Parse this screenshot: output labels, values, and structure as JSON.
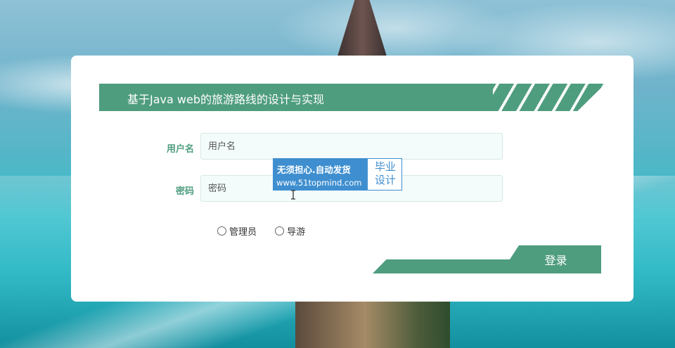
{
  "title": "基于Java web的旅游路线的设计与实现",
  "form": {
    "username": {
      "label": "用户名",
      "placeholder": "用户名",
      "value": ""
    },
    "password": {
      "label": "密码",
      "placeholder": "密码",
      "value": ""
    },
    "roles": [
      {
        "label": "管理员",
        "selected": false
      },
      {
        "label": "导游",
        "selected": false
      }
    ],
    "login_label": "登录"
  },
  "watermark": {
    "line1": "无须担心.自动发货",
    "line2": "www.51topmind.com",
    "side_top": "毕业",
    "side_bottom": "设计"
  },
  "colors": {
    "accent": "#4f9d7f",
    "watermark_blue": "#3f8fd0"
  }
}
